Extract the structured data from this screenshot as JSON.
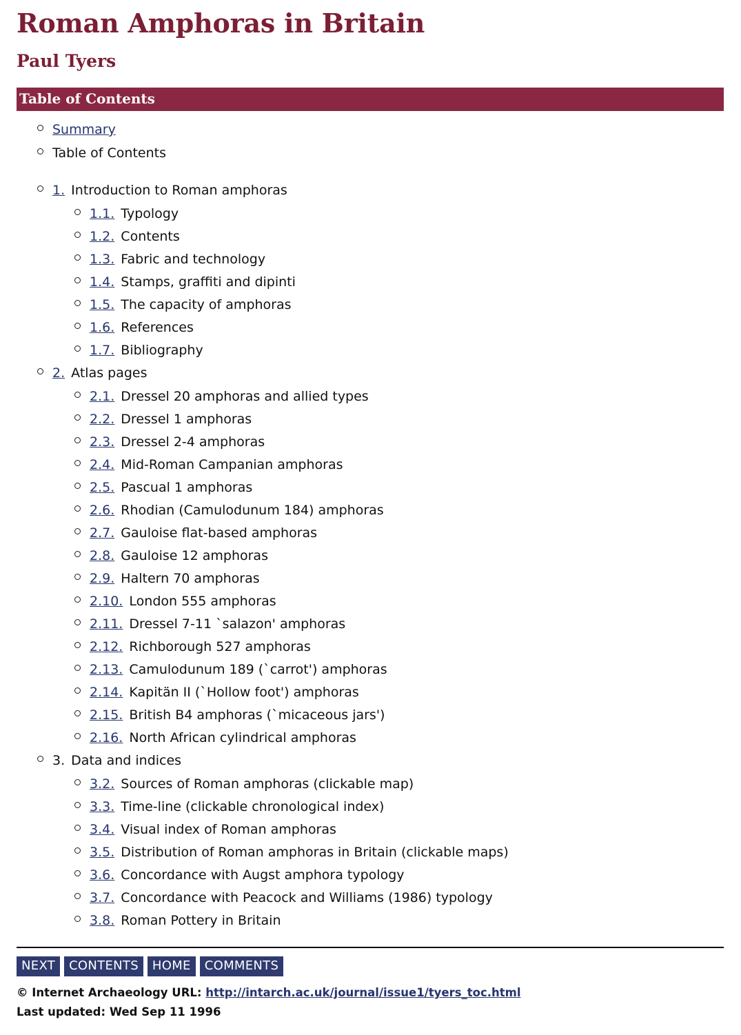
{
  "document": {
    "title": "Roman Amphoras in Britain",
    "author": "Paul Tyers"
  },
  "section_header": {
    "label": "Table of Contents",
    "background": "#8a2844",
    "text_color": "#ffffff"
  },
  "colors": {
    "heading": "#7b1f35",
    "link": "#26356e",
    "nav_button": "#2f3a6e",
    "body_text": "#111111"
  },
  "toc": {
    "front_items": [
      {
        "label": "Summary",
        "linked": true
      },
      {
        "label": "Table of Contents",
        "linked": false
      }
    ],
    "sections": [
      {
        "number": "1.",
        "title": "Introduction to Roman amphoras",
        "number_linked": true,
        "children": [
          {
            "number": "1.1.",
            "title": "Typology"
          },
          {
            "number": "1.2.",
            "title": "Contents"
          },
          {
            "number": "1.3.",
            "title": "Fabric and technology"
          },
          {
            "number": "1.4.",
            "title": "Stamps, graffiti and dipinti"
          },
          {
            "number": "1.5.",
            "title": "The capacity of amphoras"
          },
          {
            "number": "1.6.",
            "title": "References"
          },
          {
            "number": "1.7.",
            "title": "Bibliography"
          }
        ]
      },
      {
        "number": "2.",
        "title": "Atlas pages",
        "number_linked": true,
        "children": [
          {
            "number": "2.1.",
            "title": "Dressel 20 amphoras and allied types"
          },
          {
            "number": "2.2.",
            "title": "Dressel 1 amphoras"
          },
          {
            "number": "2.3.",
            "title": "Dressel 2-4 amphoras"
          },
          {
            "number": "2.4.",
            "title": "Mid-Roman Campanian amphoras"
          },
          {
            "number": "2.5.",
            "title": "Pascual 1 amphoras"
          },
          {
            "number": "2.6.",
            "title": "Rhodian (Camulodunum 184) amphoras"
          },
          {
            "number": "2.7.",
            "title": "Gauloise flat-based amphoras"
          },
          {
            "number": "2.8.",
            "title": "Gauloise 12 amphoras"
          },
          {
            "number": "2.9.",
            "title": "Haltern 70 amphoras"
          },
          {
            "number": "2.10.",
            "title": "London 555 amphoras"
          },
          {
            "number": "2.11.",
            "title": "Dressel 7-11 `salazon' amphoras"
          },
          {
            "number": "2.12.",
            "title": "Richborough 527 amphoras"
          },
          {
            "number": "2.13.",
            "title": "Camulodunum 189 (`carrot') amphoras"
          },
          {
            "number": "2.14.",
            "title": "Kapitän II (`Hollow foot') amphoras"
          },
          {
            "number": "2.15.",
            "title": "British B4 amphoras (`micaceous jars')"
          },
          {
            "number": "2.16.",
            "title": "North African cylindrical amphoras"
          }
        ]
      },
      {
        "number": "3.",
        "title": "Data and indices",
        "number_linked": false,
        "children": [
          {
            "number": "3.2.",
            "title": "Sources of Roman amphoras (clickable map)"
          },
          {
            "number": "3.3.",
            "title": "Time-line (clickable chronological index)"
          },
          {
            "number": "3.4.",
            "title": "Visual index of Roman amphoras"
          },
          {
            "number": "3.5.",
            "title": "Distribution of Roman amphoras in Britain (clickable maps)"
          },
          {
            "number": "3.6.",
            "title": "Concordance with Augst amphora typology"
          },
          {
            "number": "3.7.",
            "title": "Concordance with Peacock and Williams (1986) typology"
          },
          {
            "number": "3.8.",
            "title": "Roman Pottery in Britain"
          }
        ]
      }
    ]
  },
  "footer": {
    "nav": [
      "NEXT",
      "CONTENTS",
      "HOME",
      "COMMENTS"
    ],
    "copyright_prefix": "© Internet Archaeology URL:",
    "url": "http://intarch.ac.uk/journal/issue1/tyers_toc.html",
    "updated": "Last updated: Wed Sep 11 1996"
  }
}
